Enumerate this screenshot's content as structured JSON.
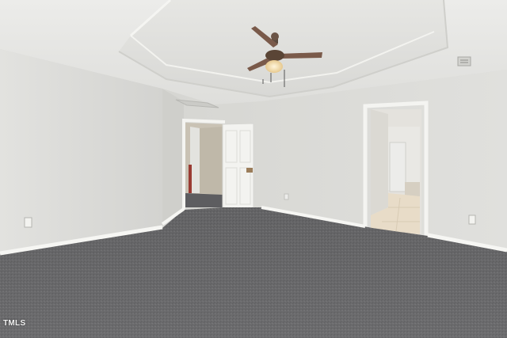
{
  "photo": {
    "watermark": "TMLS"
  },
  "colors": {
    "ceiling": "#e9e9e6",
    "walls": "#dcdcd8",
    "carpet": "#6e6e70",
    "trim": "#f4f4f1",
    "fan_blades": "#7a5a4a",
    "tile_floor": "#e8dcc8"
  }
}
